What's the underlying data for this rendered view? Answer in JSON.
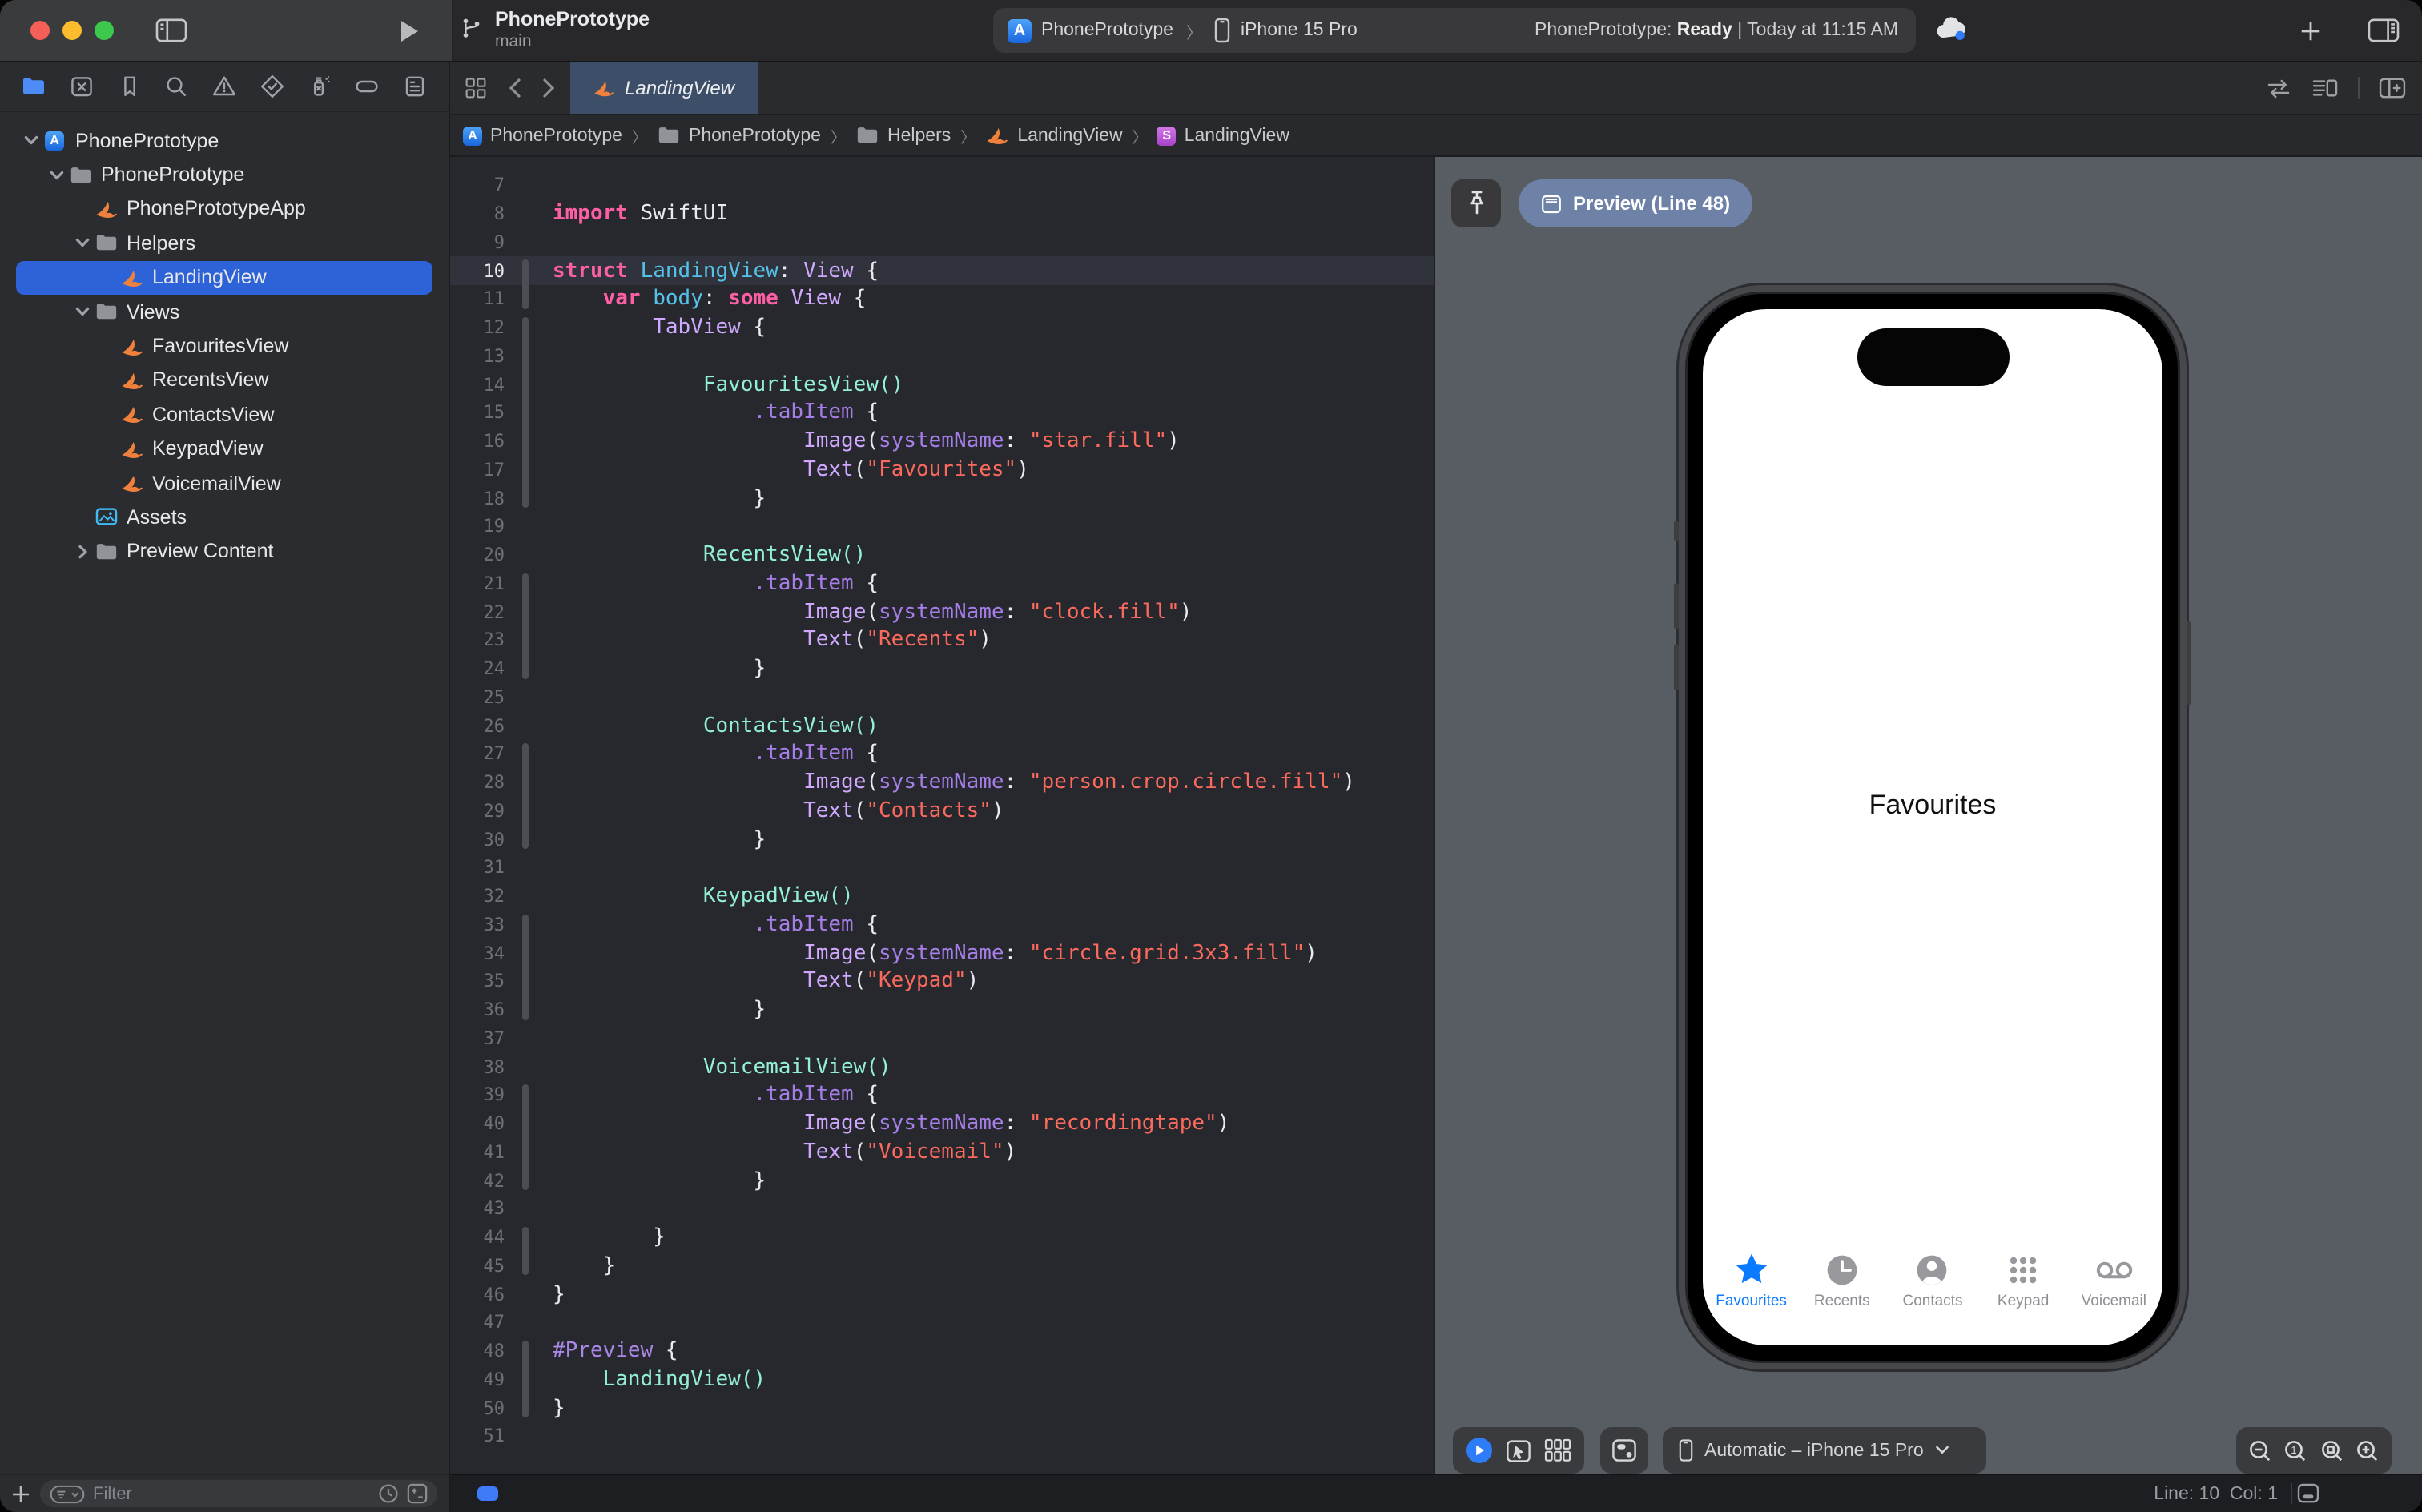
{
  "toolbar": {
    "title": "PhonePrototype",
    "branch": "main",
    "scheme_chip": {
      "project": "PhonePrototype",
      "destination": "iPhone 15 Pro"
    },
    "status": {
      "prefix": "PhonePrototype: ",
      "state": "Ready",
      "suffix": " | Today at 11:15 AM"
    }
  },
  "navigator": {
    "icons": [
      "project",
      "source-control",
      "bookmarks",
      "find",
      "issues",
      "tests",
      "debug",
      "breakpoints",
      "reports"
    ],
    "tree": [
      {
        "label": "PhonePrototype",
        "depth": 0,
        "icon": "app",
        "chevron": "down"
      },
      {
        "label": "PhonePrototype",
        "depth": 1,
        "icon": "folder",
        "chevron": "down"
      },
      {
        "label": "PhonePrototypeApp",
        "depth": 2,
        "icon": "swift"
      },
      {
        "label": "Helpers",
        "depth": 2,
        "icon": "folder",
        "chevron": "down"
      },
      {
        "label": "LandingView",
        "depth": 3,
        "icon": "swift",
        "selected": true
      },
      {
        "label": "Views",
        "depth": 2,
        "icon": "folder",
        "chevron": "down"
      },
      {
        "label": "FavouritesView",
        "depth": 3,
        "icon": "swift"
      },
      {
        "label": "RecentsView",
        "depth": 3,
        "icon": "swift"
      },
      {
        "label": "ContactsView",
        "depth": 3,
        "icon": "swift"
      },
      {
        "label": "KeypadView",
        "depth": 3,
        "icon": "swift"
      },
      {
        "label": "VoicemailView",
        "depth": 3,
        "icon": "swift"
      },
      {
        "label": "Assets",
        "depth": 2,
        "icon": "assets"
      },
      {
        "label": "Preview Content",
        "depth": 2,
        "icon": "folder",
        "chevron": "right"
      }
    ],
    "filter_placeholder": "Filter"
  },
  "editor": {
    "tab_label": "LandingView",
    "breadcrumbs": [
      {
        "label": "PhonePrototype",
        "icon": "app"
      },
      {
        "label": "PhonePrototype",
        "icon": "folder"
      },
      {
        "label": "Helpers",
        "icon": "folder"
      },
      {
        "label": "LandingView",
        "icon": "swift"
      },
      {
        "label": "LandingView",
        "icon": "struct"
      }
    ],
    "current_line": 10,
    "fold_ranges": [
      [
        10,
        11
      ],
      [
        12,
        18
      ],
      [
        21,
        24
      ],
      [
        27,
        30
      ],
      [
        33,
        36
      ],
      [
        39,
        42
      ],
      [
        44,
        45
      ],
      [
        48,
        50
      ]
    ],
    "lines": [
      {
        "n": 7,
        "tokens": []
      },
      {
        "n": 8,
        "tokens": [
          [
            "kw",
            "import"
          ],
          [
            "pl",
            " SwiftUI"
          ]
        ]
      },
      {
        "n": 9,
        "tokens": []
      },
      {
        "n": 10,
        "tokens": [
          [
            "kw",
            "struct"
          ],
          [
            "pl",
            " "
          ],
          [
            "decl",
            "LandingView"
          ],
          [
            "pl",
            ": "
          ],
          [
            "type",
            "View"
          ],
          [
            "pl",
            " {"
          ]
        ]
      },
      {
        "n": 11,
        "tokens": [
          [
            "pl",
            "    "
          ],
          [
            "kw",
            "var"
          ],
          [
            "pl",
            " "
          ],
          [
            "decl",
            "body"
          ],
          [
            "pl",
            ": "
          ],
          [
            "kw",
            "some"
          ],
          [
            "pl",
            " "
          ],
          [
            "type",
            "View"
          ],
          [
            "pl",
            " {"
          ]
        ]
      },
      {
        "n": 12,
        "tokens": [
          [
            "pl",
            "        "
          ],
          [
            "type",
            "TabView"
          ],
          [
            "pl",
            " {"
          ]
        ]
      },
      {
        "n": 13,
        "tokens": []
      },
      {
        "n": 14,
        "tokens": [
          [
            "pl",
            "            "
          ],
          [
            "proj",
            "FavouritesView()"
          ]
        ]
      },
      {
        "n": 15,
        "tokens": [
          [
            "pl",
            "                "
          ],
          [
            "member",
            ".tabItem"
          ],
          [
            "pl",
            " {"
          ]
        ]
      },
      {
        "n": 16,
        "tokens": [
          [
            "pl",
            "                    "
          ],
          [
            "type",
            "Image"
          ],
          [
            "pl",
            "("
          ],
          [
            "member",
            "systemName"
          ],
          [
            "pl",
            ": "
          ],
          [
            "str",
            "\"star.fill\""
          ],
          [
            "pl",
            ")"
          ]
        ]
      },
      {
        "n": 17,
        "tokens": [
          [
            "pl",
            "                    "
          ],
          [
            "type",
            "Text"
          ],
          [
            "pl",
            "("
          ],
          [
            "str",
            "\"Favourites\""
          ],
          [
            "pl",
            ")"
          ]
        ]
      },
      {
        "n": 18,
        "tokens": [
          [
            "pl",
            "                }"
          ]
        ]
      },
      {
        "n": 19,
        "tokens": []
      },
      {
        "n": 20,
        "tokens": [
          [
            "pl",
            "            "
          ],
          [
            "proj",
            "RecentsView()"
          ]
        ]
      },
      {
        "n": 21,
        "tokens": [
          [
            "pl",
            "                "
          ],
          [
            "member",
            ".tabItem"
          ],
          [
            "pl",
            " {"
          ]
        ]
      },
      {
        "n": 22,
        "tokens": [
          [
            "pl",
            "                    "
          ],
          [
            "type",
            "Image"
          ],
          [
            "pl",
            "("
          ],
          [
            "member",
            "systemName"
          ],
          [
            "pl",
            ": "
          ],
          [
            "str",
            "\"clock.fill\""
          ],
          [
            "pl",
            ")"
          ]
        ]
      },
      {
        "n": 23,
        "tokens": [
          [
            "pl",
            "                    "
          ],
          [
            "type",
            "Text"
          ],
          [
            "pl",
            "("
          ],
          [
            "str",
            "\"Recents\""
          ],
          [
            "pl",
            ")"
          ]
        ]
      },
      {
        "n": 24,
        "tokens": [
          [
            "pl",
            "                }"
          ]
        ]
      },
      {
        "n": 25,
        "tokens": []
      },
      {
        "n": 26,
        "tokens": [
          [
            "pl",
            "            "
          ],
          [
            "proj",
            "ContactsView()"
          ]
        ]
      },
      {
        "n": 27,
        "tokens": [
          [
            "pl",
            "                "
          ],
          [
            "member",
            ".tabItem"
          ],
          [
            "pl",
            " {"
          ]
        ]
      },
      {
        "n": 28,
        "tokens": [
          [
            "pl",
            "                    "
          ],
          [
            "type",
            "Image"
          ],
          [
            "pl",
            "("
          ],
          [
            "member",
            "systemName"
          ],
          [
            "pl",
            ": "
          ],
          [
            "str",
            "\"person.crop.circle.fill\""
          ],
          [
            "pl",
            ")"
          ]
        ]
      },
      {
        "n": 29,
        "tokens": [
          [
            "pl",
            "                    "
          ],
          [
            "type",
            "Text"
          ],
          [
            "pl",
            "("
          ],
          [
            "str",
            "\"Contacts\""
          ],
          [
            "pl",
            ")"
          ]
        ]
      },
      {
        "n": 30,
        "tokens": [
          [
            "pl",
            "                }"
          ]
        ]
      },
      {
        "n": 31,
        "tokens": []
      },
      {
        "n": 32,
        "tokens": [
          [
            "pl",
            "            "
          ],
          [
            "proj",
            "KeypadView()"
          ]
        ]
      },
      {
        "n": 33,
        "tokens": [
          [
            "pl",
            "                "
          ],
          [
            "member",
            ".tabItem"
          ],
          [
            "pl",
            " {"
          ]
        ]
      },
      {
        "n": 34,
        "tokens": [
          [
            "pl",
            "                    "
          ],
          [
            "type",
            "Image"
          ],
          [
            "pl",
            "("
          ],
          [
            "member",
            "systemName"
          ],
          [
            "pl",
            ": "
          ],
          [
            "str",
            "\"circle.grid.3x3.fill\""
          ],
          [
            "pl",
            ")"
          ]
        ]
      },
      {
        "n": 35,
        "tokens": [
          [
            "pl",
            "                    "
          ],
          [
            "type",
            "Text"
          ],
          [
            "pl",
            "("
          ],
          [
            "str",
            "\"Keypad\""
          ],
          [
            "pl",
            ")"
          ]
        ]
      },
      {
        "n": 36,
        "tokens": [
          [
            "pl",
            "                }"
          ]
        ]
      },
      {
        "n": 37,
        "tokens": []
      },
      {
        "n": 38,
        "tokens": [
          [
            "pl",
            "            "
          ],
          [
            "proj",
            "VoicemailView()"
          ]
        ]
      },
      {
        "n": 39,
        "tokens": [
          [
            "pl",
            "                "
          ],
          [
            "member",
            ".tabItem"
          ],
          [
            "pl",
            " {"
          ]
        ]
      },
      {
        "n": 40,
        "tokens": [
          [
            "pl",
            "                    "
          ],
          [
            "type",
            "Image"
          ],
          [
            "pl",
            "("
          ],
          [
            "member",
            "systemName"
          ],
          [
            "pl",
            ": "
          ],
          [
            "str",
            "\"recordingtape\""
          ],
          [
            "pl",
            ")"
          ]
        ]
      },
      {
        "n": 41,
        "tokens": [
          [
            "pl",
            "                    "
          ],
          [
            "type",
            "Text"
          ],
          [
            "pl",
            "("
          ],
          [
            "str",
            "\"Voicemail\""
          ],
          [
            "pl",
            ")"
          ]
        ]
      },
      {
        "n": 42,
        "tokens": [
          [
            "pl",
            "                }"
          ]
        ]
      },
      {
        "n": 43,
        "tokens": []
      },
      {
        "n": 44,
        "tokens": [
          [
            "pl",
            "        }"
          ]
        ]
      },
      {
        "n": 45,
        "tokens": [
          [
            "pl",
            "    }"
          ]
        ]
      },
      {
        "n": 46,
        "tokens": [
          [
            "pl",
            "}"
          ]
        ]
      },
      {
        "n": 47,
        "tokens": []
      },
      {
        "n": 48,
        "tokens": [
          [
            "macro",
            "#Preview"
          ],
          [
            "pl",
            " {"
          ]
        ]
      },
      {
        "n": 49,
        "tokens": [
          [
            "pl",
            "    "
          ],
          [
            "proj",
            "LandingView()"
          ]
        ]
      },
      {
        "n": 50,
        "tokens": [
          [
            "pl",
            "}"
          ]
        ]
      },
      {
        "n": 51,
        "tokens": []
      }
    ]
  },
  "preview": {
    "chip_label": "Preview (Line 48)",
    "device_selector": "Automatic – iPhone 15 Pro",
    "phone": {
      "screen_text": "Favourites",
      "tab_bar": [
        {
          "label": "Favourites",
          "icon": "star",
          "active": true
        },
        {
          "label": "Recents",
          "icon": "clock",
          "active": false
        },
        {
          "label": "Contacts",
          "icon": "person",
          "active": false
        },
        {
          "label": "Keypad",
          "icon": "keypad",
          "active": false
        },
        {
          "label": "Voicemail",
          "icon": "voicemail",
          "active": false
        }
      ]
    }
  },
  "statusbar": {
    "line_col": "Line: 10  Col: 1"
  },
  "colors": {
    "accent": "#2e62d8",
    "ios_blue": "#0a7aff",
    "tab_selected": "#3c4e68",
    "preview_chip": "#6e82a8",
    "preview_background": "#585c63",
    "keyword": "#fc5fa3",
    "declaration": "#56c1e8",
    "type_name": "#d0a8ff",
    "member": "#a67ee8",
    "string": "#fc6a5d",
    "project_class": "#93efd6",
    "macro": "#aa87e6"
  }
}
